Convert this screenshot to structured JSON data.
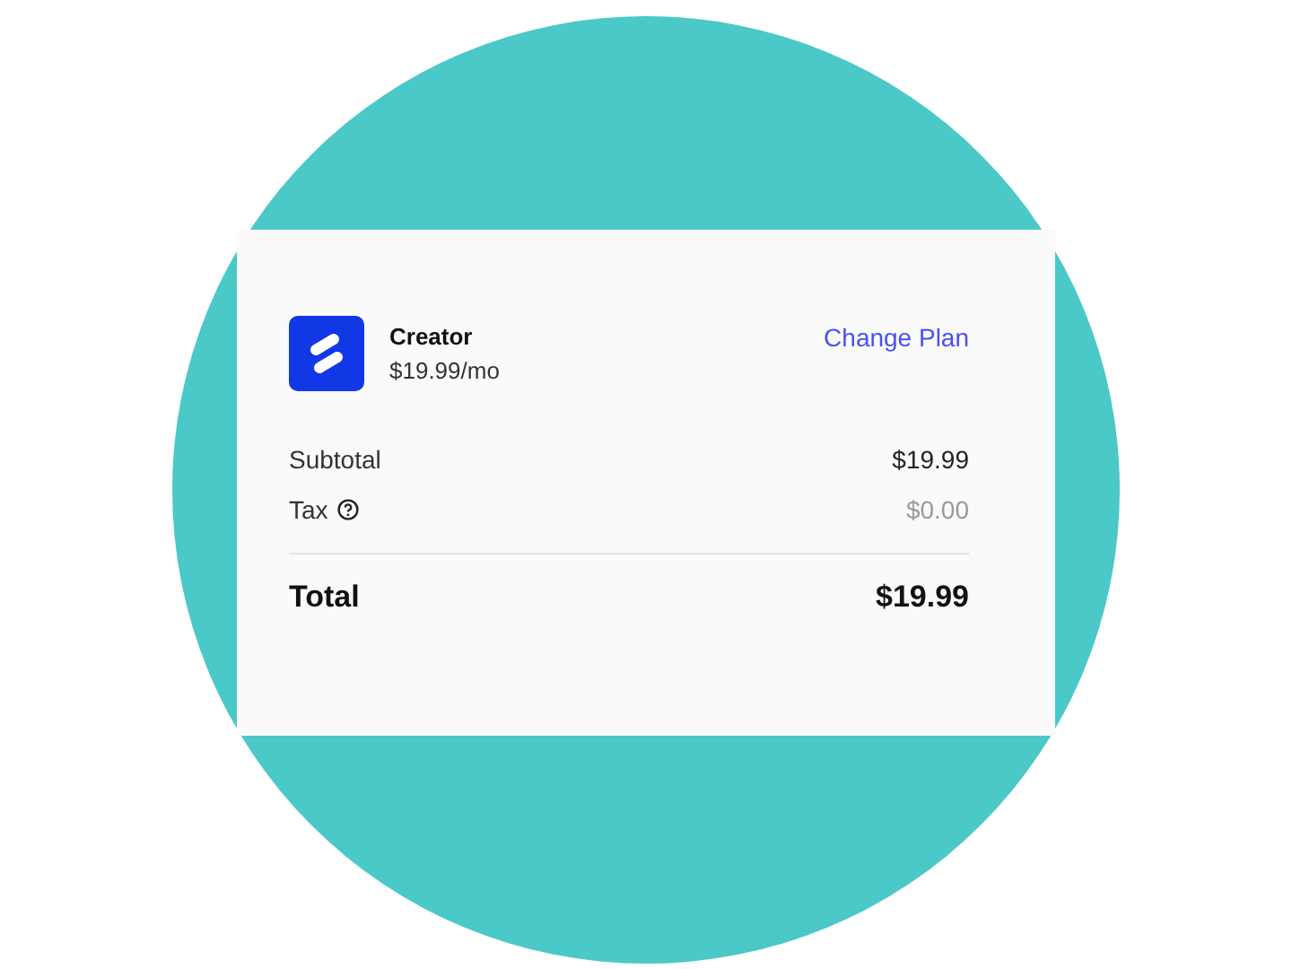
{
  "plan": {
    "name": "Creator",
    "price": "$19.99/mo",
    "action": "Change Plan"
  },
  "lines": [
    {
      "label": "Subtotal",
      "value": "$19.99",
      "has_help": false,
      "muted": false
    },
    {
      "label": "Tax",
      "value": "$0.00",
      "has_help": true,
      "muted": true
    }
  ],
  "total": {
    "label": "Total",
    "value": "$19.99"
  }
}
